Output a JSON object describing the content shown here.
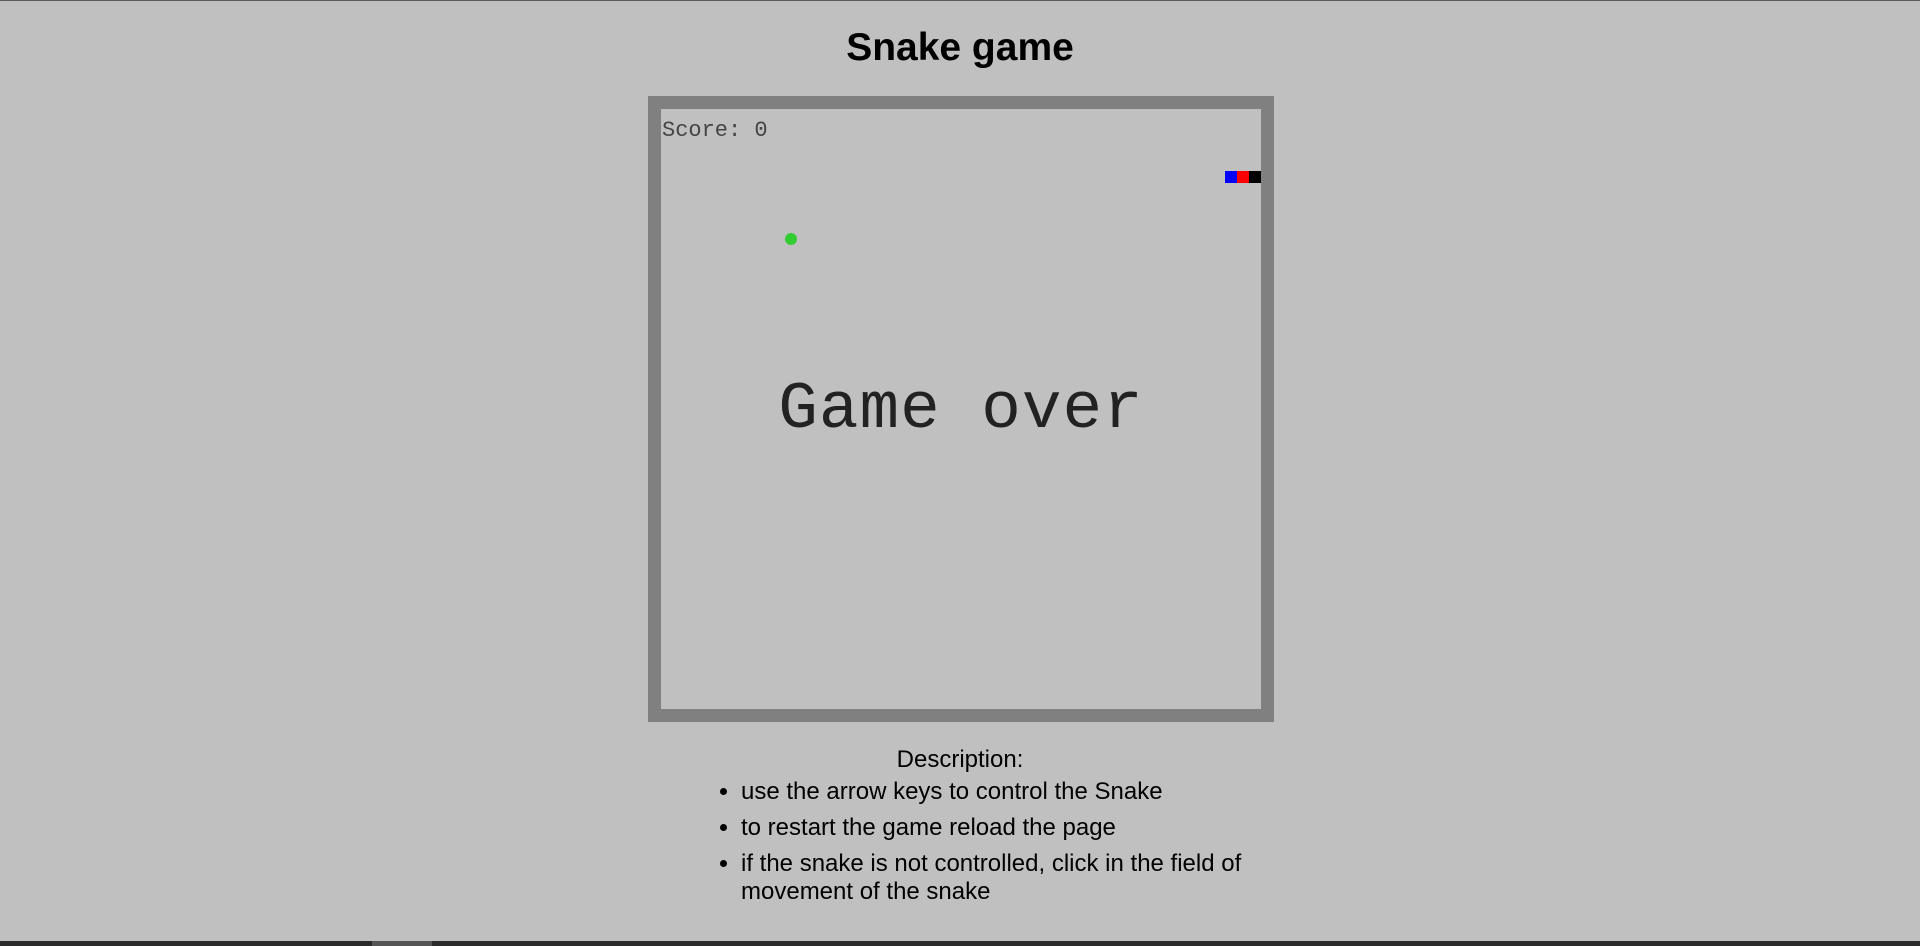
{
  "page": {
    "title": "Snake game"
  },
  "game": {
    "score_label": "Score: 0",
    "status_text": "Game over",
    "colors": {
      "board_border": "#808080",
      "board_background": "#c0c0c0",
      "food": "#33cc33",
      "snake_segments": [
        "#0000ff",
        "#ff0000",
        "#000000"
      ]
    }
  },
  "description": {
    "heading": "Description:",
    "items": [
      "use the arrow keys to control the Snake",
      "to restart the game reload the page",
      "if the snake is not controlled, click in the field of movement of the snake"
    ]
  }
}
